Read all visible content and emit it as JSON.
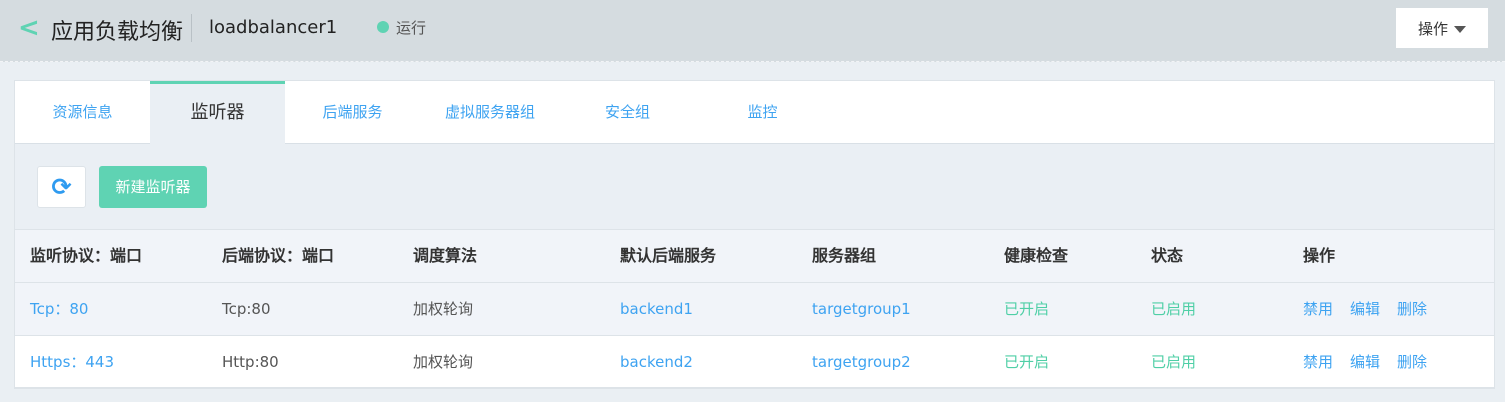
{
  "header": {
    "back_icon": "chevron-left-icon",
    "title": "应用负载均衡",
    "instance_name": "loadbalancer1",
    "status": "运行",
    "status_color": "#5fd3b3",
    "actions_label": "操作"
  },
  "tabs": [
    {
      "label": "资源信息"
    },
    {
      "label": "监听器",
      "active": true
    },
    {
      "label": "后端服务"
    },
    {
      "label": "虚拟服务器组"
    },
    {
      "label": "安全组"
    },
    {
      "label": "监控"
    }
  ],
  "toolbar": {
    "refresh_icon": "refresh-icon",
    "new_label": "新建监听器"
  },
  "table": {
    "columns": [
      "监听协议：端口",
      "后端协议：端口",
      "调度算法",
      "默认后端服务",
      "服务器组",
      "健康检查",
      "状态",
      "操作"
    ],
    "rows": [
      {
        "listener": "Tcp：80",
        "backend_proto": "Tcp:80",
        "algorithm": "加权轮询",
        "backend": "backend1",
        "group": "targetgroup1",
        "health": "已开启",
        "state": "已启用",
        "actions": [
          "禁用",
          "编辑",
          "删除"
        ]
      },
      {
        "listener": "Https：443",
        "backend_proto": "Http:80",
        "algorithm": "加权轮询",
        "backend": "backend2",
        "group": "targetgroup2",
        "health": "已开启",
        "state": "已启用",
        "actions": [
          "禁用",
          "编辑",
          "删除"
        ]
      }
    ]
  }
}
